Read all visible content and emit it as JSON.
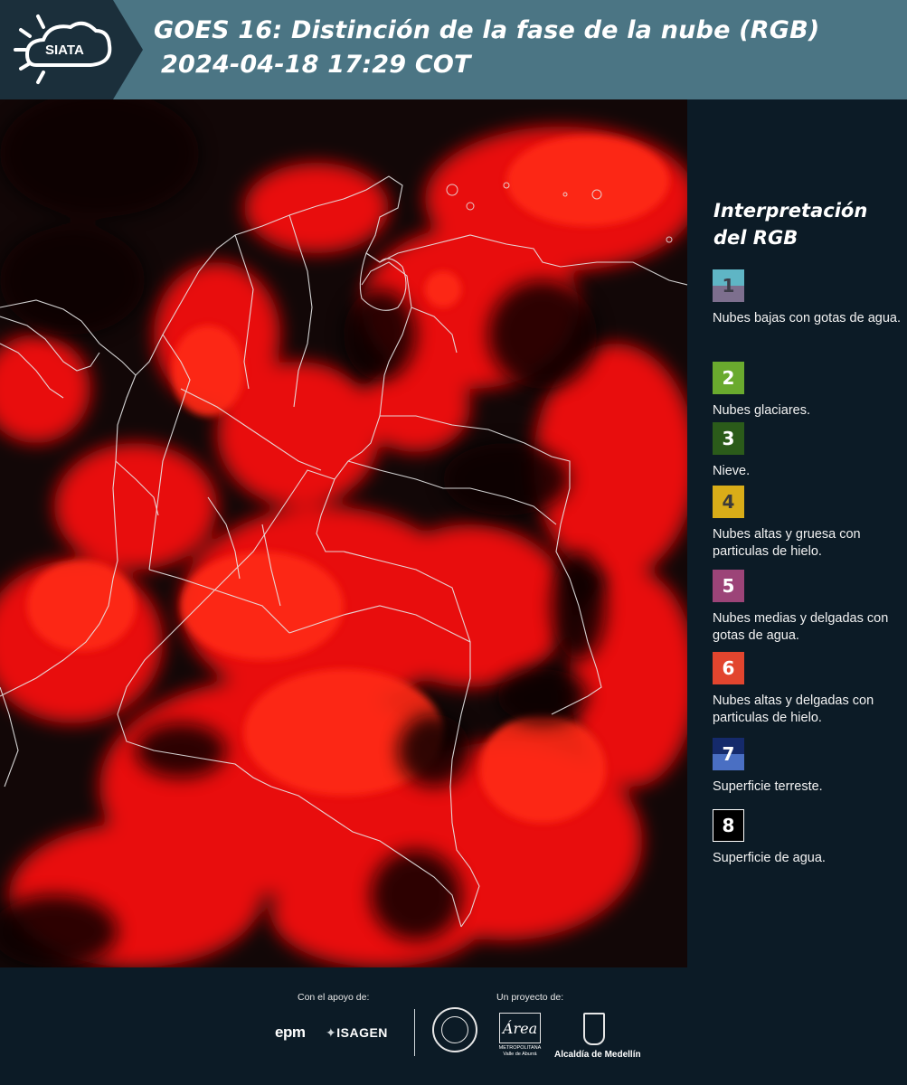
{
  "header": {
    "logo_text": "SIATA",
    "title": "GOES 16: Distinción de la fase de la nube (RGB)",
    "datetime": "2024-04-18 17:29 COT"
  },
  "legend": {
    "title_line1": "Interpretación",
    "title_line2": "del RGB",
    "items": [
      {
        "number": "1",
        "label": "Nubes bajas con gotas de agua.",
        "color_top": "#5fb5c5",
        "color_bottom": "#7d6f8e",
        "text_color": "#3c3c48"
      },
      {
        "number": "2",
        "label": "Nubes glaciares.",
        "color_top": "#6aaa2e",
        "color_bottom": "#6aaa2e",
        "text_color": "#ffffff"
      },
      {
        "number": "3",
        "label": "Nieve.",
        "color_top": "#2b5b1a",
        "color_bottom": "#2b5b1a",
        "text_color": "#ffffff"
      },
      {
        "number": "4",
        "label": "Nubes altas y gruesa con particulas de hielo.",
        "color_top": "#d9ad18",
        "color_bottom": "#d9ad18",
        "text_color": "#3a3a3a"
      },
      {
        "number": "5",
        "label": "Nubes medias y delgadas con gotas de agua.",
        "color_top": "#9c4478",
        "color_bottom": "#9c4478",
        "text_color": "#ffffff"
      },
      {
        "number": "6",
        "label": "Nubes altas y delgadas con particulas de hielo.",
        "color_top": "#e2452e",
        "color_bottom": "#e2452e",
        "text_color": "#ffffff"
      },
      {
        "number": "7",
        "label": "Superficie terreste.",
        "color_top": "#152a6b",
        "color_bottom": "#4a6fc3",
        "text_color": "#ffffff"
      },
      {
        "number": "8",
        "label": "Superficie de agua.",
        "color_top": "#000000",
        "color_bottom": "#000000",
        "text_color": "#ffffff"
      }
    ]
  },
  "footer": {
    "support_label": "Con el apoyo de:",
    "project_label": "Un proyecto de:",
    "sponsor_1": "epm",
    "sponsor_2": "ISAGEN",
    "partner_area_text": "METROPOLITANA Valle de Aburrá",
    "partner_alcaldia": "Alcaldía de Medellín"
  },
  "map": {
    "cloud_color": "#ff1a10",
    "clear_color": "#0d0606",
    "border_color": "#e8e8e8"
  }
}
